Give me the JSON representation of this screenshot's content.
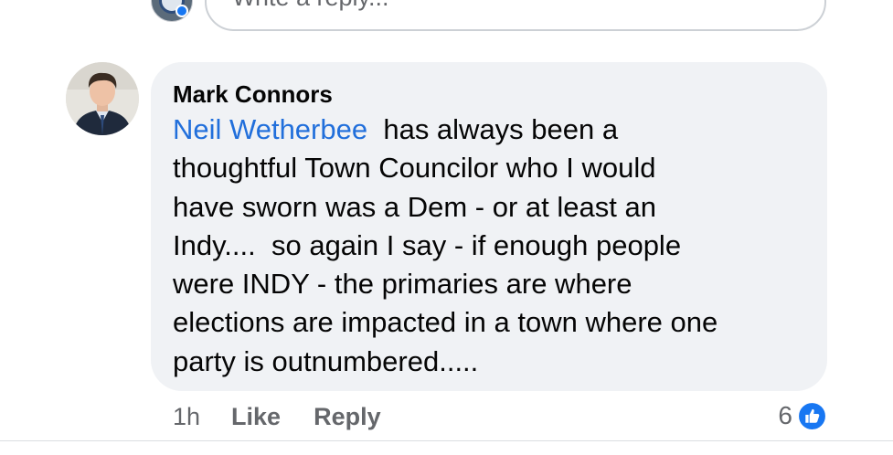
{
  "reply_input": {
    "placeholder": "Write a reply..."
  },
  "comment": {
    "author": "Mark Connors",
    "mention": "Neil Wetherbee",
    "body": "  has always been a\nthoughtful Town Councilor who I would\nhave sworn was a Dem - or at least an\nIndy....  so again I say - if enough people\nwere INDY - the primaries are where\nelections are impacted in a town where one\nparty is outnumbered.....",
    "time": "1h",
    "like_label": "Like",
    "reply_label": "Reply",
    "reaction_count": "6",
    "reaction_icon": "like-reaction-icon"
  },
  "colors": {
    "bubble": "#f0f2f5",
    "mention": "#216fdb",
    "secondary_text": "#65676b",
    "like_blue": "#1877f2"
  }
}
